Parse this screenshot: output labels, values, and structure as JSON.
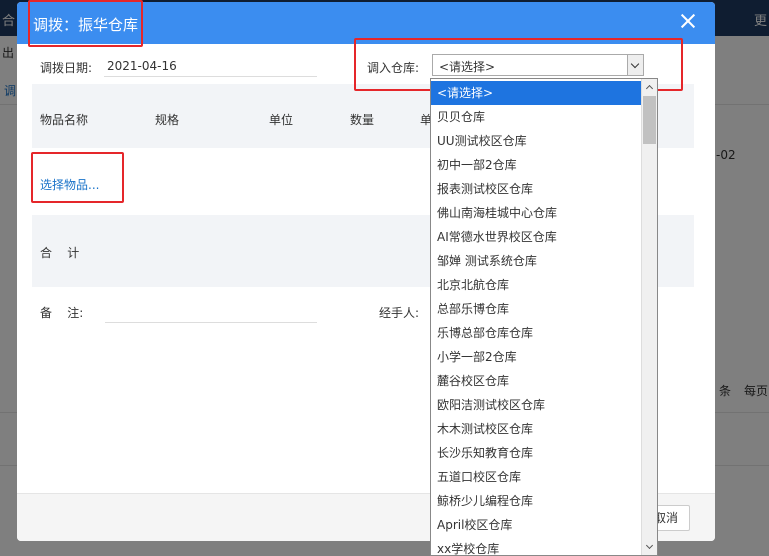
{
  "background": {
    "topbar_items": [
      "合",
      "更"
    ],
    "left_labels": [
      "出",
      "调"
    ],
    "right_texts": [
      "-02",
      "条",
      "每页"
    ]
  },
  "modal": {
    "title": "调拨：振华仓库",
    "date_label": "调拨日期:",
    "date_value": "2021-04-16",
    "warehouse_label": "调入仓库:",
    "warehouse_selected": "<请选择>",
    "columns": [
      "物品名称",
      "规格",
      "单位",
      "数量",
      "单"
    ],
    "select_items_link": "选择物品...",
    "total_label": "合    计",
    "remark_label": "备    注:",
    "handler_label": "经手人:",
    "cancel_label": "取消"
  },
  "dropdown": {
    "options": [
      "<请选择>",
      "贝贝仓库",
      "UU测试校区仓库",
      "初中一部2仓库",
      "报表测试校区仓库",
      "佛山南海桂城中心仓库",
      "AI常德水世界校区仓库",
      "邹婵 测试系统仓库",
      "北京北航仓库",
      "总部乐博仓库",
      "乐博总部仓库仓库",
      "小学一部2仓库",
      "麓谷校区仓库",
      "欧阳洁测试校区仓库",
      "木木测试校区仓库",
      "长沙乐知教育仓库",
      "五道口校区仓库",
      "鲸桥少儿编程仓库",
      "April校区仓库",
      "xx学校仓库"
    ],
    "selected_index": 0
  },
  "colors": {
    "header": "#3b8df0",
    "highlight": "#e5262a",
    "link": "#1a73c9",
    "selected": "#1e74e0"
  }
}
